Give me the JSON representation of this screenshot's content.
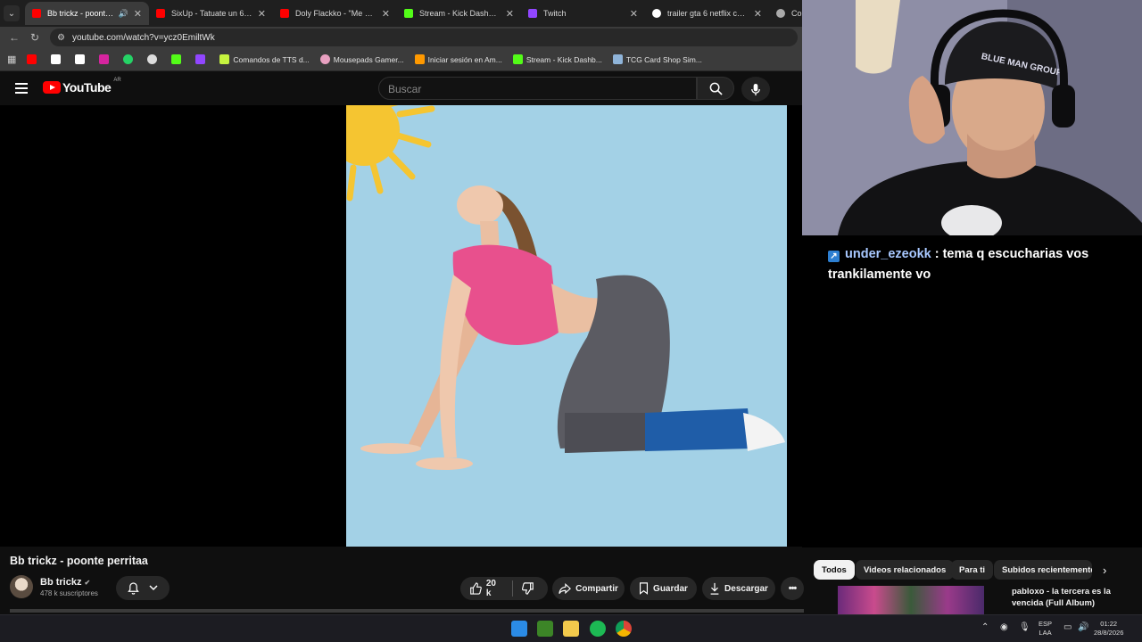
{
  "browser": {
    "tabs": [
      {
        "title": "Bb trickz - poonte perritaa",
        "favicon": "youtube",
        "active": true
      },
      {
        "title": "SixUp - Tatuate un 66 (Video Oficial)",
        "favicon": "youtube"
      },
      {
        "title": "Doly Flackko - \"Me Desvelo\"",
        "favicon": "youtube"
      },
      {
        "title": "Stream - Kick Dashboard",
        "favicon": "kick"
      },
      {
        "title": "Twitch",
        "favicon": "twitch"
      },
      {
        "title": "trailer gta 6 netflix cuevana",
        "favicon": "google"
      },
      {
        "title": "Configuración",
        "favicon": "gear"
      }
    ],
    "url": "youtube.com/watch?v=ycz0EmiltWk",
    "bookmarks": [
      {
        "label": "",
        "icon": "youtube-icon",
        "color": "#ff0000"
      },
      {
        "label": "",
        "icon": "x-icon",
        "color": "#ffffff"
      },
      {
        "label": "",
        "icon": "tiktok-icon",
        "color": "#ffffff"
      },
      {
        "label": "",
        "icon": "instagram-icon",
        "color": "#d6249f"
      },
      {
        "label": "",
        "icon": "whatsapp-icon",
        "color": "#25d366"
      },
      {
        "label": "",
        "icon": "chatgpt-icon",
        "color": "#dddddd"
      },
      {
        "label": "",
        "icon": "kick-icon",
        "color": "#53fc18"
      },
      {
        "label": "",
        "icon": "twitch-icon",
        "color": "#9146ff"
      },
      {
        "label": "Comandos de TTS d...",
        "icon": "tts-icon",
        "color": "#c6f43f"
      },
      {
        "label": "Mousepads Gamer...",
        "icon": "store-icon",
        "color": "#e8a0c0"
      },
      {
        "label": "Iniciar sesión en Am...",
        "icon": "amazon-icon",
        "color": "#ff9900"
      },
      {
        "label": "Stream - Kick Dashb...",
        "icon": "kick-icon",
        "color": "#53fc18"
      },
      {
        "label": "TCG Card Shop Sim...",
        "icon": "steam-icon",
        "color": "#8fb4d9"
      }
    ]
  },
  "youtube": {
    "logo_text": "YouTube",
    "country": "AR",
    "search_placeholder": "Buscar",
    "video_title": "Bb trickz - poonte perritaa",
    "channel_name": "Bb trickz",
    "subscribers": "478 k suscriptores",
    "likes": "20 k",
    "share_label": "Compartir",
    "save_label": "Guardar",
    "download_label": "Descargar",
    "chips": [
      "Todos",
      "Videos relacionados",
      "Para ti",
      "Subidos recientemente"
    ],
    "reco_title": "pabloxo - la tercera es la vencida (Full Album)"
  },
  "stream_overlay": {
    "chat_user": "under_ezeokk",
    "chat_message": ": tema q escucharias vos trankilamente vo",
    "cap_text": "BLUE MAN GROUP"
  },
  "taskbar": {
    "lang_top": "ESP",
    "lang_bottom": "LAA",
    "time": "01:22",
    "date": "28/8/2026"
  }
}
